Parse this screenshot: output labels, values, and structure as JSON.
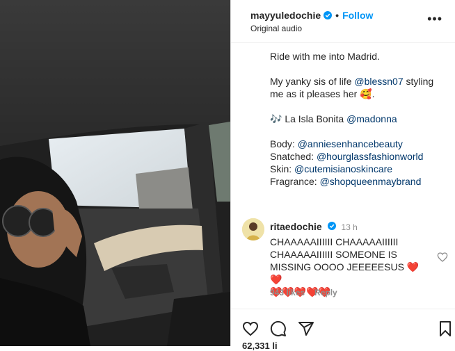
{
  "post": {
    "username": "mayyuledochie",
    "separator": "•",
    "follow_label": "Follow",
    "audio": "Original audio",
    "more": "•••"
  },
  "caption": {
    "line1": "Ride with me into Madrid.",
    "line2_pre": "My yanky sis of life ",
    "line2_mention": "@blessn07",
    "line2_post": " styling me as it pleases her 🥰.",
    "music_emoji": "🎶",
    "music_text": " La Isla Bonita ",
    "music_mention": "@madonna",
    "credits": [
      {
        "label": "Body: ",
        "mention": "@anniesenhancebeauty"
      },
      {
        "label": "Snatched: ",
        "mention": "@hourglassfashionworld"
      },
      {
        "label": "Skin: ",
        "mention": "@cutemisianoskincare"
      },
      {
        "label": "Fragrance: ",
        "mention": "@shopqueenmaybrand"
      }
    ]
  },
  "comment": {
    "username": "ritaedochie",
    "time": "13 h",
    "text": "CHAAAAAIIIIII CHAAAAAIIIIII CHAAAAAIIIIII SOMEONE IS MISSING OOOO JEEEEESUS",
    "hearts_inline": "❤️❤️",
    "hearts_line": "❤️❤️❤️❤️❤️",
    "likes": "943 likes",
    "reply": "Reply"
  },
  "footer": {
    "likes_count": "62,331 li"
  },
  "icons": {
    "verified": "verified-badge-icon",
    "like": "heart-icon",
    "comment": "comment-icon",
    "share": "share-icon",
    "save": "bookmark-icon",
    "more": "more-options-icon"
  },
  "colors": {
    "link": "#0095f6",
    "mention": "#00376b",
    "heart": "#ed4956",
    "verified": "#0095f6"
  }
}
